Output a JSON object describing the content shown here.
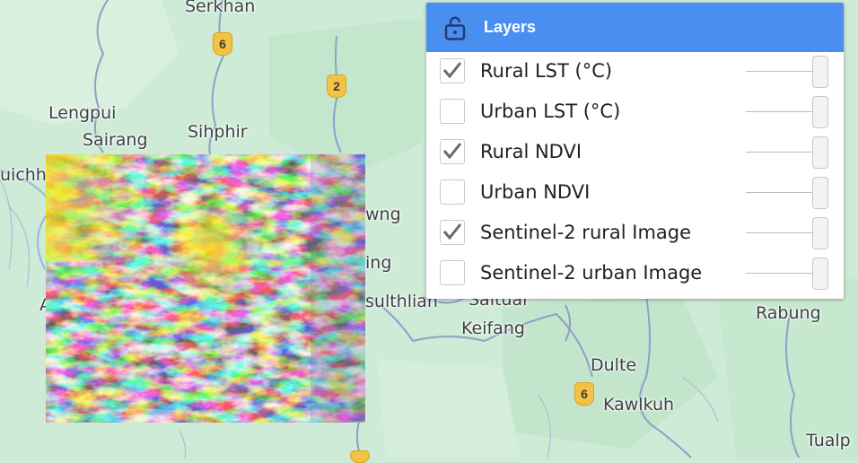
{
  "map": {
    "places": [
      "Serkhan",
      "Lengpui",
      "Sairang",
      "Sihphir",
      "uichh",
      "wng",
      "ing",
      "sulthliah",
      "Saitual",
      "Keifang",
      "Dulte",
      "Kawlkuh",
      "Rabung",
      "Tualp",
      "A"
    ],
    "route_shields": [
      "6",
      "2",
      "6"
    ]
  },
  "layers_panel": {
    "title": "Layers",
    "lock_icon": "lock-open-icon",
    "layers": [
      {
        "label": "Rural LST (°C)",
        "checked": true
      },
      {
        "label": "Urban LST (°C)",
        "checked": false
      },
      {
        "label": "Rural NDVI",
        "checked": true
      },
      {
        "label": "Urban NDVI",
        "checked": false
      },
      {
        "label": "Sentinel-2 rural Image",
        "checked": true
      },
      {
        "label": "Sentinel-2 urban Image",
        "checked": false
      }
    ]
  },
  "colors": {
    "header": "#4a8ef0",
    "ndvi_low": "#1f1fd0",
    "ndvi_high": "#f2ec1c",
    "road": "#8e9fc9",
    "highway": "#f5c342"
  }
}
